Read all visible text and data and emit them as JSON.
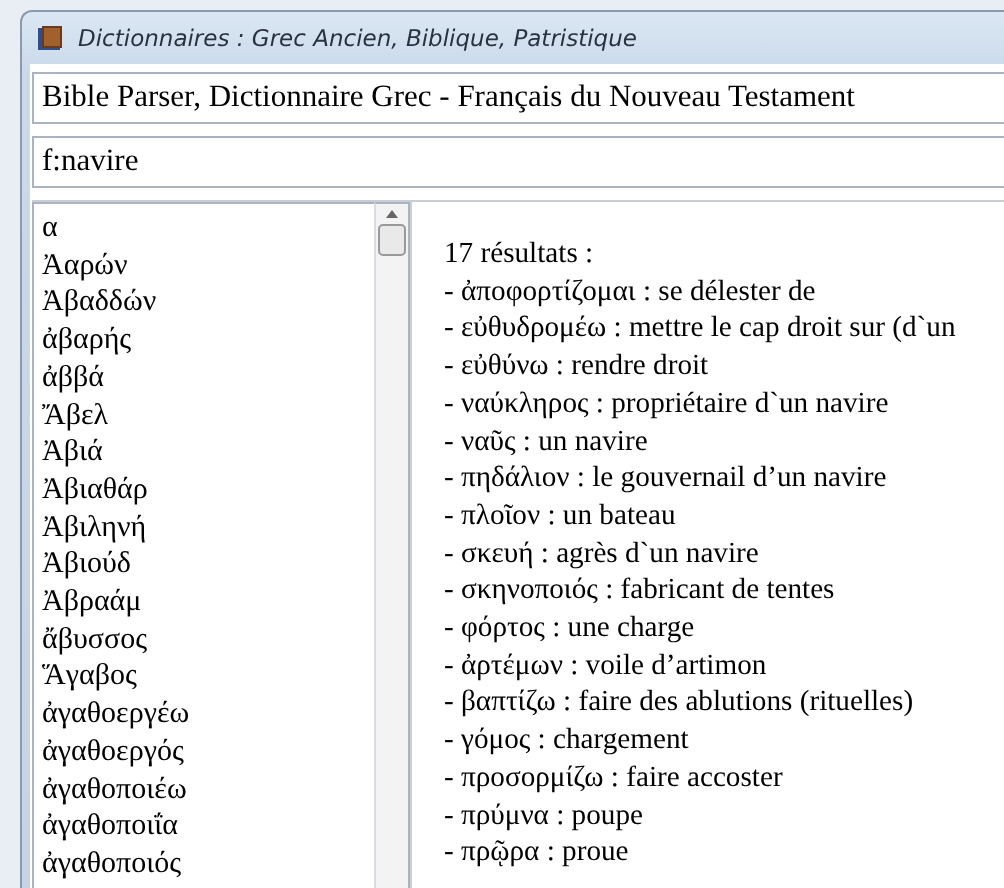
{
  "window": {
    "title": "Dictionnaires : Grec Ancien, Biblique, Patristique"
  },
  "dictionary": {
    "value": "Bible Parser, Dictionnaire Grec - Français du Nouveau Testament"
  },
  "search": {
    "value": "f:navire"
  },
  "word_list": {
    "items": [
      {
        "text": "α",
        "selected": false
      },
      {
        "text": "Ἀαρών",
        "selected": false
      },
      {
        "text": "Ἀβαδδών",
        "selected": false
      },
      {
        "text": "ἀβαρής",
        "selected": false
      },
      {
        "text": "ἀββά",
        "selected": false
      },
      {
        "text": "Ἄβελ",
        "selected": false
      },
      {
        "text": "Ἀβιά",
        "selected": false
      },
      {
        "text": "Ἀβιαθάρ",
        "selected": false
      },
      {
        "text": "Ἀβιληνή",
        "selected": false
      },
      {
        "text": "Ἀβιούδ",
        "selected": false
      },
      {
        "text": "Ἀβραάμ",
        "selected": false
      },
      {
        "text": "ἄβυσσος",
        "selected": false
      },
      {
        "text": "Ἅγαβος",
        "selected": false
      },
      {
        "text": "ἀγαθοεργέω",
        "selected": false
      },
      {
        "text": "ἀγαθοεργός",
        "selected": false
      },
      {
        "text": "ἀγαθοποιέω",
        "selected": false
      },
      {
        "text": "ἀγαθοποιΐα",
        "selected": false
      },
      {
        "text": "ἀγαθοποιός",
        "selected": false
      }
    ]
  },
  "results": {
    "heading": "17 résultats :",
    "lines": [
      "- ἀποφορτίζομαι : se délester de",
      "- εὐθυδρομέω : mettre le cap droit sur (d`un",
      "- εὐθύνω : rendre droit",
      "- ναύκληρος : propriétaire d`un navire",
      "- ναῦς : un navire",
      "- πηδάλιον : le gouvernail d’un navire",
      "- πλοῖον : un bateau",
      "- σκευή : agrès d`un navire",
      "- σκηνοποιός : fabricant de tentes",
      "- φόρτος : une charge",
      "- ἀρτέμων : voile d’artimon",
      "- βαπτίζω : faire des ablutions (rituelles)",
      "- γόμος : chargement",
      "- προσορμίζω : faire accoster",
      "- πρύμνα : poupe",
      "- πρῷρα : proue"
    ]
  }
}
